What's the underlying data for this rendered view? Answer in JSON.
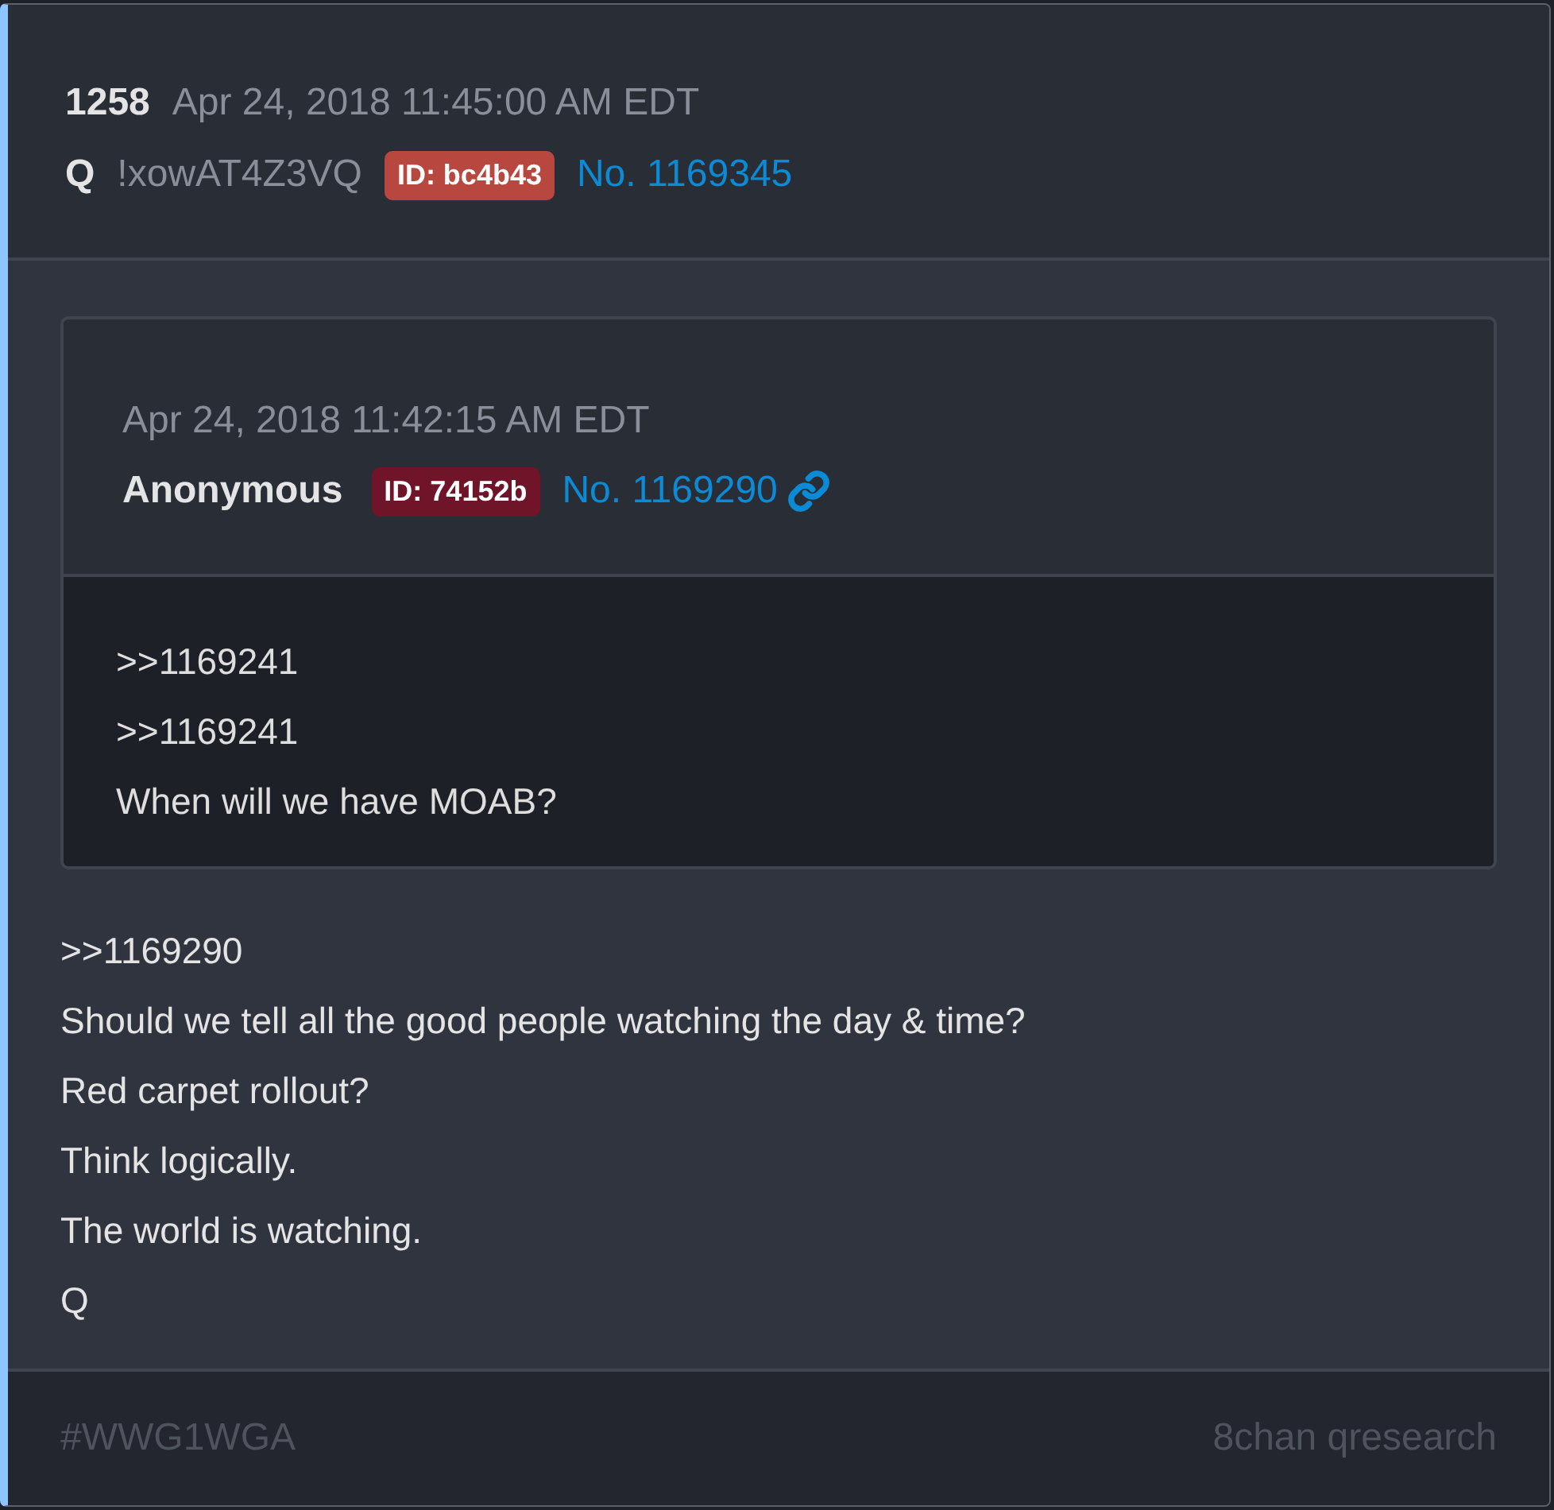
{
  "post": {
    "number": "1258",
    "date": "Apr 24, 2018 11:45:00 AM EDT",
    "author": "Q",
    "tripcode": "!xowAT4Z3VQ",
    "id_badge": {
      "label": "ID: bc4b43",
      "color": "#b8473f"
    },
    "post_link": "No. 1169345"
  },
  "quoted_post": {
    "date": "Apr 24, 2018 11:42:15 AM EDT",
    "author": "Anonymous",
    "id_badge": {
      "label": "ID: 74152b",
      "color": "#70142a"
    },
    "post_link": "No. 1169290",
    "lines": [
      ">>1169241",
      ">>1169241",
      "When will we have MOAB?"
    ]
  },
  "lines": [
    ">>1169290",
    "Should we tell all the good people watching the day & time?",
    "Red carpet rollout?",
    "Think logically.",
    "The world is watching.",
    "Q"
  ],
  "footer": {
    "hashtag": "#WWG1WGA",
    "source": "8chan qresearch"
  }
}
